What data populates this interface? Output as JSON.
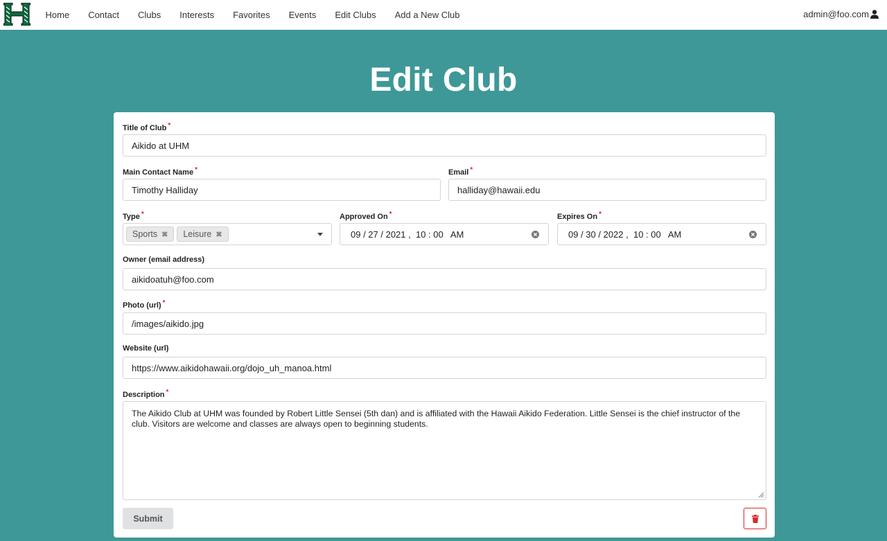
{
  "colors": {
    "background": "#3e9897",
    "required": "#db2828",
    "logo_green": "#0a6b3d"
  },
  "nav": {
    "links": [
      "Home",
      "Contact",
      "Clubs",
      "Interests",
      "Favorites",
      "Events",
      "Edit Clubs",
      "Add a New Club"
    ],
    "user": "admin@foo.com"
  },
  "page": {
    "title": "Edit Club"
  },
  "form": {
    "title_label": "Title of Club",
    "title_value": "Aikido at UHM",
    "contact_label": "Main Contact Name",
    "contact_value": "Timothy Halliday",
    "email_label": "Email",
    "email_value": "halliday@hawaii.edu",
    "type_label": "Type",
    "types": [
      "Sports",
      "Leisure"
    ],
    "approved_label": "Approved On",
    "approved_value": "09 / 27 / 2021 ,  10 : 00   AM",
    "expires_label": "Expires On",
    "expires_value": "09 / 30 / 2022 ,  10 : 00   AM",
    "owner_label": "Owner (email address)",
    "owner_value": "aikidoatuh@foo.com",
    "photo_label": "Photo (url)",
    "photo_value": "/images/aikido.jpg",
    "website_label": "Website (url)",
    "website_value": "https://www.aikidohawaii.org/dojo_uh_manoa.html",
    "description_label": "Description",
    "description_value": "The Aikido Club at UHM was founded by Robert Little Sensei (5th dan) and is affiliated with the Hawaii Aikido Federation. Little Sensei is the chief instructor of the club. Visitors are welcome and classes are always open to beginning students.",
    "submit_label": "Submit",
    "required_mark": "*"
  }
}
